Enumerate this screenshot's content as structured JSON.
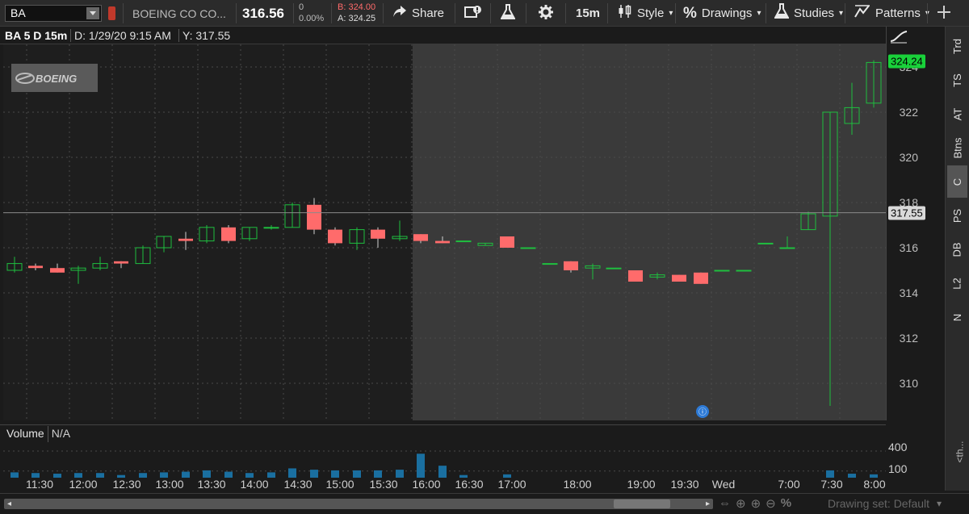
{
  "toolbar": {
    "symbol": "BA",
    "company": "BOEING CO CO...",
    "last": "316.56",
    "change": "0",
    "change_pct": "0.00%",
    "bid": "B: 324.00",
    "ask": "A: 324.25",
    "share_label": "Share",
    "timeframe": "15m",
    "style_label": "Style",
    "drawings_label": "Drawings",
    "studies_label": "Studies",
    "patterns_label": "Patterns"
  },
  "header": {
    "title": "BA 5 D 15m",
    "date_readout": "D: 1/29/20 9:15 AM",
    "y_readout": "Y: 317.55"
  },
  "logo_text": "BOEING",
  "colors": {
    "up": "#1fbf3f",
    "down": "#ff6b6b",
    "volume": "#1a6fa0",
    "accent": "#19d13a"
  },
  "y_axis": {
    "ticks": [
      "324",
      "322",
      "320",
      "318",
      "316",
      "314",
      "312",
      "310"
    ],
    "last_tag": "324.24",
    "cursor_tag": "317.55"
  },
  "right_tabs": [
    "Trd",
    "TS",
    "AT",
    "Btns",
    "C",
    "PS",
    "DB",
    "L2",
    "N"
  ],
  "right_tab_more": "<th...",
  "volume": {
    "label": "Volume",
    "value": "N/A",
    "ticks": [
      "400",
      "100"
    ]
  },
  "x_labels": [
    "11:30",
    "12:00",
    "12:30",
    "13:00",
    "13:30",
    "14:00",
    "14:30",
    "15:00",
    "15:30",
    "16:00",
    "16:30",
    "17:00",
    "18:00",
    "19:00",
    "19:30",
    "Wed",
    "7:00",
    "7:30",
    "8:00"
  ],
  "bottom": {
    "drawing_set": "Drawing set: Default"
  },
  "chart_data": {
    "type": "candlestick",
    "symbol": "BA",
    "interval": "15m",
    "ylim": [
      308.5,
      325
    ],
    "candles": [
      {
        "o": 315.0,
        "h": 315.6,
        "l": 314.9,
        "c": 315.3
      },
      {
        "o": 315.2,
        "h": 315.3,
        "l": 315.0,
        "c": 315.1
      },
      {
        "o": 315.1,
        "h": 315.3,
        "l": 314.9,
        "c": 314.9
      },
      {
        "o": 315.0,
        "h": 315.2,
        "l": 314.4,
        "c": 315.1
      },
      {
        "o": 315.1,
        "h": 315.6,
        "l": 315.0,
        "c": 315.3
      },
      {
        "o": 315.4,
        "h": 315.4,
        "l": 315.1,
        "c": 315.3
      },
      {
        "o": 315.3,
        "h": 316.1,
        "l": 315.3,
        "c": 316.0
      },
      {
        "o": 316.0,
        "h": 316.5,
        "l": 315.8,
        "c": 316.5
      },
      {
        "o": 316.4,
        "h": 316.7,
        "l": 315.9,
        "c": 316.3
      },
      {
        "o": 316.3,
        "h": 317.0,
        "l": 316.2,
        "c": 316.9
      },
      {
        "o": 316.9,
        "h": 317.0,
        "l": 316.2,
        "c": 316.3
      },
      {
        "o": 316.4,
        "h": 316.9,
        "l": 316.3,
        "c": 316.9
      },
      {
        "o": 316.9,
        "h": 317.0,
        "l": 316.8,
        "c": 316.9
      },
      {
        "o": 316.9,
        "h": 318.0,
        "l": 316.9,
        "c": 317.9
      },
      {
        "o": 317.9,
        "h": 318.2,
        "l": 316.6,
        "c": 316.8
      },
      {
        "o": 316.8,
        "h": 316.9,
        "l": 316.1,
        "c": 316.2
      },
      {
        "o": 316.2,
        "h": 316.9,
        "l": 315.9,
        "c": 316.8
      },
      {
        "o": 316.8,
        "h": 316.9,
        "l": 316.0,
        "c": 316.4
      },
      {
        "o": 316.4,
        "h": 317.2,
        "l": 316.3,
        "c": 316.5
      },
      {
        "o": 316.6,
        "h": 316.6,
        "l": 316.2,
        "c": 316.3
      },
      {
        "o": 316.3,
        "h": 316.5,
        "l": 316.2,
        "c": 316.2
      },
      {
        "o": 316.3,
        "h": 316.3,
        "l": 316.3,
        "c": 316.3
      },
      {
        "o": 316.1,
        "h": 316.2,
        "l": 316.1,
        "c": 316.2
      },
      {
        "o": 316.5,
        "h": 316.5,
        "l": 316.0,
        "c": 316.0
      },
      {
        "o": 316.0,
        "h": 316.0,
        "l": 316.0,
        "c": 316.0
      },
      {
        "o": 315.3,
        "h": 315.3,
        "l": 315.3,
        "c": 315.3
      },
      {
        "o": 315.4,
        "h": 315.4,
        "l": 314.9,
        "c": 315.0
      },
      {
        "o": 315.1,
        "h": 315.3,
        "l": 314.6,
        "c": 315.2
      },
      {
        "o": 315.1,
        "h": 315.1,
        "l": 315.1,
        "c": 315.1
      },
      {
        "o": 315.0,
        "h": 315.0,
        "l": 314.5,
        "c": 314.5
      },
      {
        "o": 314.7,
        "h": 314.9,
        "l": 314.6,
        "c": 314.8
      },
      {
        "o": 314.8,
        "h": 314.8,
        "l": 314.5,
        "c": 314.5
      },
      {
        "o": 314.9,
        "h": 314.9,
        "l": 314.4,
        "c": 314.4
      },
      {
        "o": 315.0,
        "h": 315.0,
        "l": 315.0,
        "c": 315.0
      },
      {
        "o": 315.0,
        "h": 315.0,
        "l": 315.0,
        "c": 315.0
      },
      {
        "o": 316.2,
        "h": 316.2,
        "l": 316.2,
        "c": 316.2
      },
      {
        "o": 316.0,
        "h": 316.5,
        "l": 316.0,
        "c": 316.0
      },
      {
        "o": 316.8,
        "h": 317.6,
        "l": 316.8,
        "c": 317.5
      },
      {
        "o": 317.4,
        "h": 322.0,
        "l": 309.0,
        "c": 322.0
      },
      {
        "o": 321.5,
        "h": 323.3,
        "l": 321.0,
        "c": 322.2
      },
      {
        "o": 322.4,
        "h": 324.3,
        "l": 322.2,
        "c": 324.2
      }
    ],
    "volumes": [
      80,
      70,
      60,
      70,
      70,
      40,
      70,
      80,
      90,
      110,
      90,
      70,
      80,
      140,
      120,
      110,
      110,
      110,
      120,
      360,
      180,
      40,
      0,
      0,
      0,
      0,
      0,
      0,
      0,
      0,
      0,
      0,
      0,
      0,
      0,
      0,
      0,
      0,
      0,
      0,
      0,
      0,
      0,
      0,
      0,
      0,
      0,
      0,
      0,
      0
    ],
    "volumes_visible": [
      {
        "i": 0,
        "v": 80
      },
      {
        "i": 1,
        "v": 70
      },
      {
        "i": 2,
        "v": 60
      },
      {
        "i": 3,
        "v": 70
      },
      {
        "i": 4,
        "v": 70
      },
      {
        "i": 5,
        "v": 40
      },
      {
        "i": 6,
        "v": 70
      },
      {
        "i": 7,
        "v": 80
      },
      {
        "i": 8,
        "v": 90
      },
      {
        "i": 9,
        "v": 110
      },
      {
        "i": 10,
        "v": 90
      },
      {
        "i": 11,
        "v": 70
      },
      {
        "i": 12,
        "v": 80
      },
      {
        "i": 13,
        "v": 140
      },
      {
        "i": 14,
        "v": 120
      },
      {
        "i": 15,
        "v": 110
      },
      {
        "i": 16,
        "v": 110
      },
      {
        "i": 17,
        "v": 110
      },
      {
        "i": 18,
        "v": 120
      },
      {
        "i": 19,
        "v": 360
      },
      {
        "i": 20,
        "v": 180
      },
      {
        "i": 21,
        "v": 40
      },
      {
        "i": 23,
        "v": 50
      },
      {
        "i": 38,
        "v": 110
      },
      {
        "i": 39,
        "v": 60
      },
      {
        "i": 40,
        "v": 50
      }
    ],
    "cursor_y": 317.55
  }
}
